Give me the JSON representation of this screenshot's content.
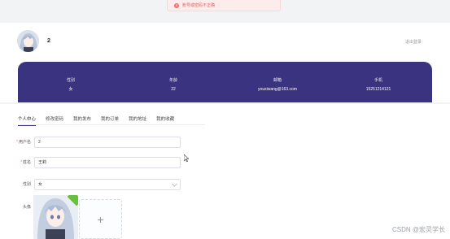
{
  "toast": {
    "icon": "close-circle-icon",
    "message": "账号或密码不正确"
  },
  "profile": {
    "nickname": "2",
    "logout_label": "退出登录",
    "stats": [
      {
        "label": "性别",
        "value": "女"
      },
      {
        "label": "年龄",
        "value": "22"
      },
      {
        "label": "邮箱",
        "value": "youxiwang@163.com"
      },
      {
        "label": "手机",
        "value": "15251214121"
      }
    ]
  },
  "tabs": [
    {
      "label": "个人中心",
      "active": true
    },
    {
      "label": "修改密码",
      "active": false
    },
    {
      "label": "我的发布",
      "active": false
    },
    {
      "label": "我的订单",
      "active": false
    },
    {
      "label": "我的地址",
      "active": false
    },
    {
      "label": "我的收藏",
      "active": false
    }
  ],
  "form": {
    "username": {
      "label": "用户名",
      "value": "2",
      "required": true
    },
    "name": {
      "label": "姓名",
      "value": "王莉",
      "required": true
    },
    "gender": {
      "label": "性别",
      "value": "女"
    },
    "avatar": {
      "label": "头像",
      "add_symbol": "+"
    }
  },
  "colors": {
    "accent": "#3a3380",
    "error": "#f56c6c",
    "success": "#67c23a"
  },
  "watermark": "CSDN @宏灵学长"
}
